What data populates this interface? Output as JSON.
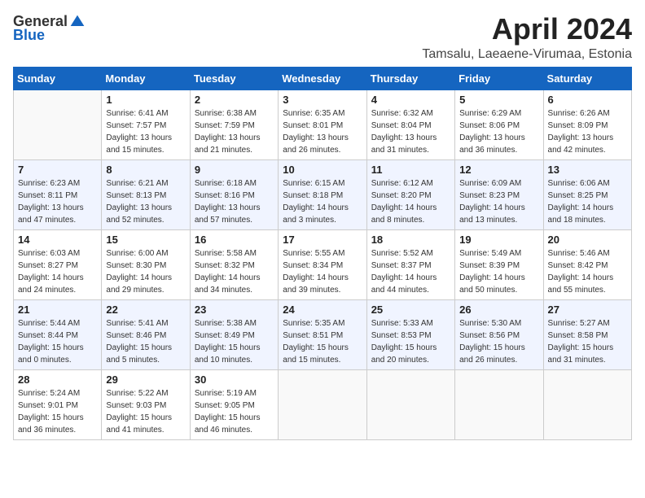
{
  "header": {
    "logo_general": "General",
    "logo_blue": "Blue",
    "title": "April 2024",
    "location": "Tamsalu, Laeaene-Virumaa, Estonia"
  },
  "weekdays": [
    "Sunday",
    "Monday",
    "Tuesday",
    "Wednesday",
    "Thursday",
    "Friday",
    "Saturday"
  ],
  "weeks": [
    [
      {
        "day": "",
        "info": ""
      },
      {
        "day": "1",
        "info": "Sunrise: 6:41 AM\nSunset: 7:57 PM\nDaylight: 13 hours\nand 15 minutes."
      },
      {
        "day": "2",
        "info": "Sunrise: 6:38 AM\nSunset: 7:59 PM\nDaylight: 13 hours\nand 21 minutes."
      },
      {
        "day": "3",
        "info": "Sunrise: 6:35 AM\nSunset: 8:01 PM\nDaylight: 13 hours\nand 26 minutes."
      },
      {
        "day": "4",
        "info": "Sunrise: 6:32 AM\nSunset: 8:04 PM\nDaylight: 13 hours\nand 31 minutes."
      },
      {
        "day": "5",
        "info": "Sunrise: 6:29 AM\nSunset: 8:06 PM\nDaylight: 13 hours\nand 36 minutes."
      },
      {
        "day": "6",
        "info": "Sunrise: 6:26 AM\nSunset: 8:09 PM\nDaylight: 13 hours\nand 42 minutes."
      }
    ],
    [
      {
        "day": "7",
        "info": "Sunrise: 6:23 AM\nSunset: 8:11 PM\nDaylight: 13 hours\nand 47 minutes."
      },
      {
        "day": "8",
        "info": "Sunrise: 6:21 AM\nSunset: 8:13 PM\nDaylight: 13 hours\nand 52 minutes."
      },
      {
        "day": "9",
        "info": "Sunrise: 6:18 AM\nSunset: 8:16 PM\nDaylight: 13 hours\nand 57 minutes."
      },
      {
        "day": "10",
        "info": "Sunrise: 6:15 AM\nSunset: 8:18 PM\nDaylight: 14 hours\nand 3 minutes."
      },
      {
        "day": "11",
        "info": "Sunrise: 6:12 AM\nSunset: 8:20 PM\nDaylight: 14 hours\nand 8 minutes."
      },
      {
        "day": "12",
        "info": "Sunrise: 6:09 AM\nSunset: 8:23 PM\nDaylight: 14 hours\nand 13 minutes."
      },
      {
        "day": "13",
        "info": "Sunrise: 6:06 AM\nSunset: 8:25 PM\nDaylight: 14 hours\nand 18 minutes."
      }
    ],
    [
      {
        "day": "14",
        "info": "Sunrise: 6:03 AM\nSunset: 8:27 PM\nDaylight: 14 hours\nand 24 minutes."
      },
      {
        "day": "15",
        "info": "Sunrise: 6:00 AM\nSunset: 8:30 PM\nDaylight: 14 hours\nand 29 minutes."
      },
      {
        "day": "16",
        "info": "Sunrise: 5:58 AM\nSunset: 8:32 PM\nDaylight: 14 hours\nand 34 minutes."
      },
      {
        "day": "17",
        "info": "Sunrise: 5:55 AM\nSunset: 8:34 PM\nDaylight: 14 hours\nand 39 minutes."
      },
      {
        "day": "18",
        "info": "Sunrise: 5:52 AM\nSunset: 8:37 PM\nDaylight: 14 hours\nand 44 minutes."
      },
      {
        "day": "19",
        "info": "Sunrise: 5:49 AM\nSunset: 8:39 PM\nDaylight: 14 hours\nand 50 minutes."
      },
      {
        "day": "20",
        "info": "Sunrise: 5:46 AM\nSunset: 8:42 PM\nDaylight: 14 hours\nand 55 minutes."
      }
    ],
    [
      {
        "day": "21",
        "info": "Sunrise: 5:44 AM\nSunset: 8:44 PM\nDaylight: 15 hours\nand 0 minutes."
      },
      {
        "day": "22",
        "info": "Sunrise: 5:41 AM\nSunset: 8:46 PM\nDaylight: 15 hours\nand 5 minutes."
      },
      {
        "day": "23",
        "info": "Sunrise: 5:38 AM\nSunset: 8:49 PM\nDaylight: 15 hours\nand 10 minutes."
      },
      {
        "day": "24",
        "info": "Sunrise: 5:35 AM\nSunset: 8:51 PM\nDaylight: 15 hours\nand 15 minutes."
      },
      {
        "day": "25",
        "info": "Sunrise: 5:33 AM\nSunset: 8:53 PM\nDaylight: 15 hours\nand 20 minutes."
      },
      {
        "day": "26",
        "info": "Sunrise: 5:30 AM\nSunset: 8:56 PM\nDaylight: 15 hours\nand 26 minutes."
      },
      {
        "day": "27",
        "info": "Sunrise: 5:27 AM\nSunset: 8:58 PM\nDaylight: 15 hours\nand 31 minutes."
      }
    ],
    [
      {
        "day": "28",
        "info": "Sunrise: 5:24 AM\nSunset: 9:01 PM\nDaylight: 15 hours\nand 36 minutes."
      },
      {
        "day": "29",
        "info": "Sunrise: 5:22 AM\nSunset: 9:03 PM\nDaylight: 15 hours\nand 41 minutes."
      },
      {
        "day": "30",
        "info": "Sunrise: 5:19 AM\nSunset: 9:05 PM\nDaylight: 15 hours\nand 46 minutes."
      },
      {
        "day": "",
        "info": ""
      },
      {
        "day": "",
        "info": ""
      },
      {
        "day": "",
        "info": ""
      },
      {
        "day": "",
        "info": ""
      }
    ]
  ]
}
